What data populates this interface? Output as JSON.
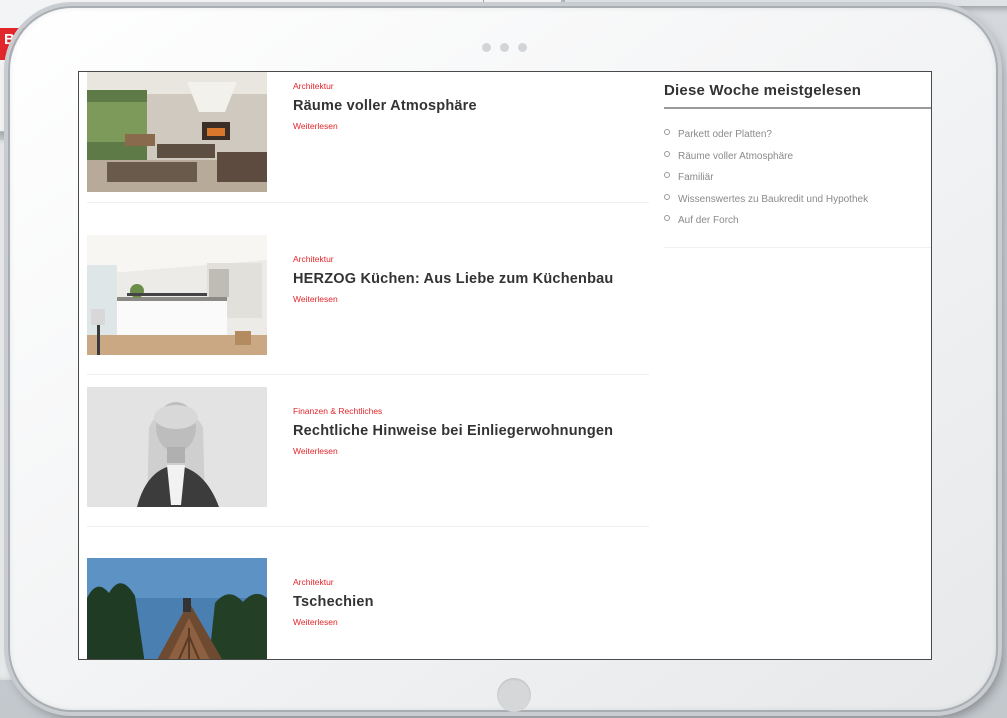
{
  "background": {
    "badge_text": "Ba"
  },
  "articles": [
    {
      "category": "Architektur",
      "title": "Räume voller Atmosphäre",
      "read_more": "Weiterlesen",
      "image": "living-room-photo"
    },
    {
      "category": "Architektur",
      "title": "HERZOG Küchen: Aus Liebe zum Küchenbau",
      "read_more": "Weiterlesen",
      "image": "kitchen-photo"
    },
    {
      "category": "Finanzen & Rechtliches",
      "title": "Rechtliche Hinweise bei Einliegerwohnungen",
      "read_more": "Weiterlesen",
      "image": "portrait-photo"
    },
    {
      "category": "Architektur",
      "title": "Tschechien",
      "read_more": "Weiterlesen",
      "image": "wooden-house-photo"
    }
  ],
  "sidebar": {
    "heading": "Diese Woche meistgelesen",
    "items": [
      "Parkett oder Platten?",
      "Räume voller Atmosphäre",
      "Familiär",
      "Wissenswertes zu Baukredit und Hypothek",
      "Auf der Forch"
    ]
  },
  "colors": {
    "accent": "#e2262b",
    "title_text": "#333333",
    "muted_text": "#8a8a8a"
  }
}
